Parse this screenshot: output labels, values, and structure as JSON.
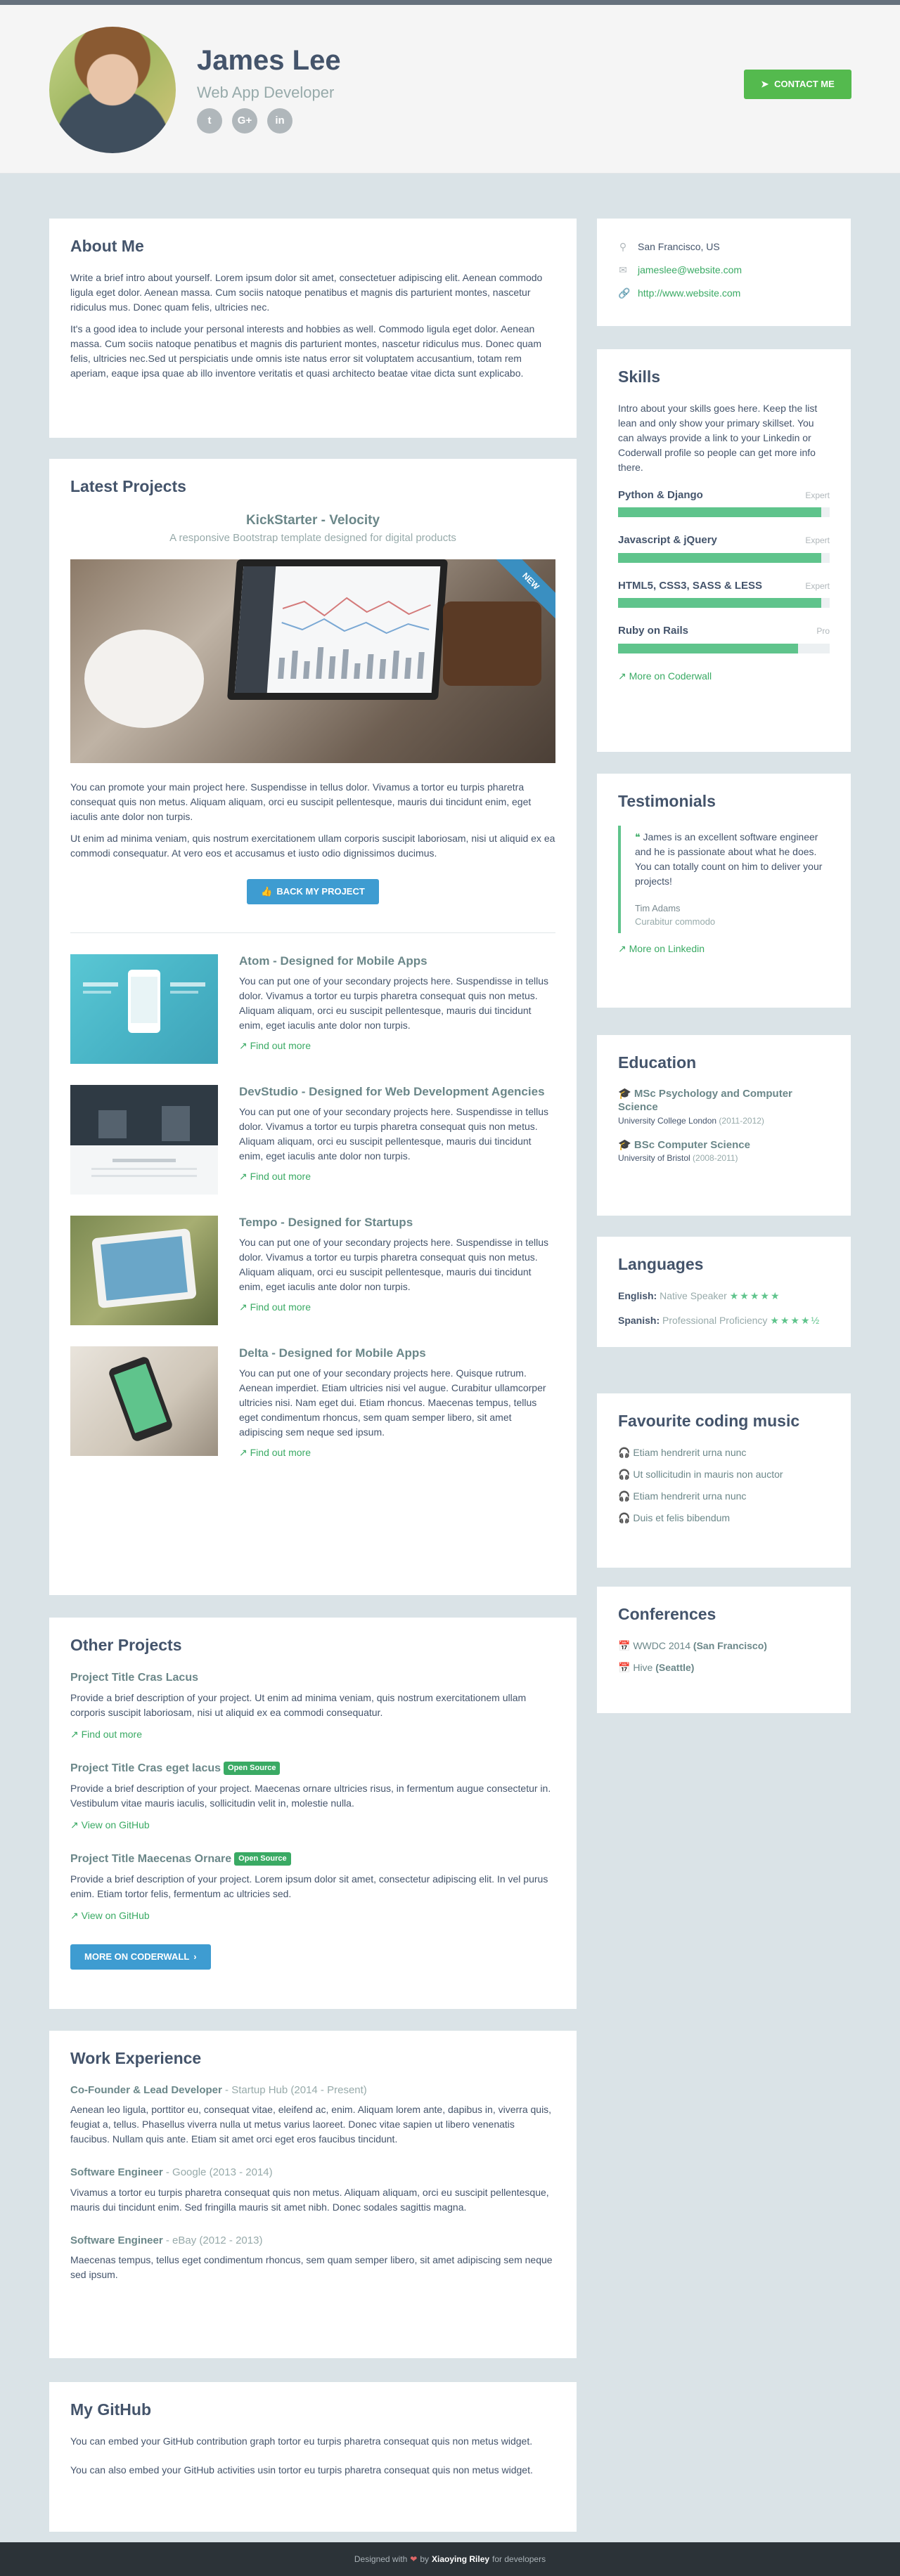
{
  "header": {
    "name": "James Lee",
    "title": "Web App Developer",
    "contact_label": "CONTACT ME",
    "social": [
      {
        "icon": "twitter-icon",
        "glyph": "t"
      },
      {
        "icon": "google-plus-icon",
        "glyph": "G+"
      },
      {
        "icon": "linkedin-icon",
        "glyph": "in"
      }
    ]
  },
  "about": {
    "heading": "About Me",
    "p1": "Write a brief intro about yourself. Lorem ipsum dolor sit amet, consectetuer adipiscing elit. Aenean commodo ligula eget dolor. Aenean massa. Cum sociis natoque penatibus et magnis dis parturient montes, nascetur ridiculus mus. Donec quam felis, ultricies nec.",
    "p2": "It's a good idea to include your personal interests and hobbies as well. Commodo ligula eget dolor. Aenean massa. Cum sociis natoque penatibus et magnis dis parturient montes, nascetur ridiculus mus. Donec quam felis, ultricies nec.Sed ut perspiciatis unde omnis iste natus error sit voluptatem accusantium, totam rem aperiam, eaque ipsa quae ab illo inventore veritatis et quasi architecto beatae vitae dicta sunt explicabo."
  },
  "latest": {
    "heading": "Latest Projects",
    "featured": {
      "title": "KickStarter - Velocity",
      "subtitle": "A responsive Bootstrap template designed for digital products",
      "ribbon": "NEW",
      "p1": "You can promote your main project here. Suspendisse in tellus dolor. Vivamus a tortor eu turpis pharetra consequat quis non metus. Aliquam aliquam, orci eu suscipit pellentesque, mauris dui tincidunt enim, eget iaculis ante dolor non turpis.",
      "p2": "Ut enim ad minima veniam, quis nostrum exercitationem ullam corporis suscipit laboriosam, nisi ut aliquid ex ea commodi consequatur. At vero eos et accusamus et iusto odio dignissimos ducimus.",
      "button": "BACK MY PROJECT"
    },
    "projects": [
      {
        "title": "Atom - Designed for Mobile Apps",
        "desc": "You can put one of your secondary projects here. Suspendisse in tellus dolor. Vivamus a tortor eu turpis pharetra consequat quis non metus. Aliquam aliquam, orci eu suscipit pellentesque, mauris dui tincidunt enim, eget iaculis ante dolor non turpis.",
        "link": "Find out more"
      },
      {
        "title": "DevStudio - Designed for Web Development Agencies",
        "desc": "You can put one of your secondary projects here. Suspendisse in tellus dolor. Vivamus a tortor eu turpis pharetra consequat quis non metus. Aliquam aliquam, orci eu suscipit pellentesque, mauris dui tincidunt enim, eget iaculis ante dolor non turpis.",
        "link": "Find out more"
      },
      {
        "title": "Tempo - Designed for Startups",
        "desc": "You can put one of your secondary projects here. Suspendisse in tellus dolor. Vivamus a tortor eu turpis pharetra consequat quis non metus. Aliquam aliquam, orci eu suscipit pellentesque, mauris dui tincidunt enim, eget iaculis ante dolor non turpis.",
        "link": "Find out more"
      },
      {
        "title": "Delta - Designed for Mobile Apps",
        "desc": "You can put one of your secondary projects here. Quisque rutrum. Aenean imperdiet. Etiam ultricies nisi vel augue. Curabitur ullamcorper ultricies nisi. Nam eget dui. Etiam rhoncus. Maecenas tempus, tellus eget condimentum rhoncus, sem quam semper libero, sit amet adipiscing sem neque sed ipsum.",
        "link": "Find out more"
      }
    ]
  },
  "other": {
    "heading": "Other Projects",
    "items": [
      {
        "title": "Project Title Cras Lacus",
        "badge": "",
        "desc": "Provide a brief description of your project. Ut enim ad minima veniam, quis nostrum exercitationem ullam corporis suscipit laboriosam, nisi ut aliquid ex ea commodi consequatur.",
        "link": "Find out more"
      },
      {
        "title": "Project Title Cras eget lacus",
        "badge": "Open Source",
        "desc": "Provide a brief description of your project. Maecenas ornare ultricies risus, in fermentum augue consectetur in. Vestibulum vitae mauris iaculis, sollicitudin velit in, molestie nulla.",
        "link": "View on GitHub"
      },
      {
        "title": "Project Title Maecenas Ornare",
        "badge": "Open Source",
        "desc": "Provide a brief description of your project. Lorem ipsum dolor sit amet, consectetur adipiscing elit. In vel purus enim. Etiam tortor felis, fermentum ac ultricies sed.",
        "link": "View on GitHub"
      }
    ],
    "button": "MORE ON CODERWALL"
  },
  "work": {
    "heading": "Work Experience",
    "items": [
      {
        "role": "Co-Founder & Lead Developer",
        "company": " - Startup Hub (2014 - Present)",
        "desc": "Aenean leo ligula, porttitor eu, consequat vitae, eleifend ac, enim. Aliquam lorem ante, dapibus in, viverra quis, feugiat a, tellus. Phasellus viverra nulla ut metus varius laoreet. Donec vitae sapien ut libero venenatis faucibus. Nullam quis ante. Etiam sit amet orci eget eros faucibus tincidunt."
      },
      {
        "role": "Software Engineer",
        "company": " - Google (2013 - 2014)",
        "desc": "Vivamus a tortor eu turpis pharetra consequat quis non metus. Aliquam aliquam, orci eu suscipit pellentesque, mauris dui tincidunt enim. Sed fringilla mauris sit amet nibh. Donec sodales sagittis magna."
      },
      {
        "role": "Software Engineer",
        "company": " - eBay (2012 - 2013)",
        "desc": "Maecenas tempus, tellus eget condimentum rhoncus, sem quam semper libero, sit amet adipiscing sem neque sed ipsum."
      }
    ]
  },
  "github": {
    "heading": "My GitHub",
    "p1": "You can embed your GitHub contribution graph tortor eu turpis pharetra consequat quis non metus widget.",
    "p2": "You can also embed your GitHub activities usin tortor eu turpis pharetra consequat quis non metus widget."
  },
  "info": {
    "location": "San Francisco, US",
    "email": "jameslee@website.com",
    "website": "http://www.website.com"
  },
  "skills": {
    "heading": "Skills",
    "intro": "Intro about your skills goes here. Keep the list lean and only show your primary skillset. You can always provide a link to your Linkedin or Coderwall profile so people can get more info there.",
    "items": [
      {
        "name": "Python & Django",
        "level": "Expert",
        "pct": 96
      },
      {
        "name": "Javascript & jQuery",
        "level": "Expert",
        "pct": 96
      },
      {
        "name": "HTML5, CSS3, SASS & LESS",
        "level": "Expert",
        "pct": 96
      },
      {
        "name": "Ruby on Rails",
        "level": "Pro",
        "pct": 85
      }
    ],
    "link": "More on Coderwall"
  },
  "testimonials": {
    "heading": "Testimonials",
    "quote": "James is an excellent software engineer and he is passionate about what he does. You can totally count on him to deliver your projects!",
    "name": "Tim Adams",
    "role": "Curabitur commodo",
    "link": "More on Linkedin"
  },
  "education": {
    "heading": "Education",
    "items": [
      {
        "degree": "MSc Psychology and Computer Science",
        "school": "University College London",
        "years": " (2011-2012)"
      },
      {
        "degree": "BSc Computer Science",
        "school": "University of Bristol",
        "years": " (2008-2011)"
      }
    ]
  },
  "languages": {
    "heading": "Languages",
    "items": [
      {
        "name": "English:",
        "level": " Native Speaker",
        "stars": "★★★★★"
      },
      {
        "name": "Spanish:",
        "level": " Professional Proficiency",
        "stars": "★★★★½"
      }
    ]
  },
  "music": {
    "heading": "Favourite coding music",
    "items": [
      "Etiam hendrerit urna nunc",
      "Ut sollicitudin in mauris non auctor",
      "Etiam hendrerit urna nunc",
      "Duis et felis bibendum"
    ]
  },
  "conferences": {
    "heading": "Conferences",
    "items": [
      {
        "name": "WWDC 2014",
        "place": "(San Francisco)"
      },
      {
        "name": "Hive",
        "place": "(Seattle)"
      }
    ]
  },
  "footer": {
    "prefix": "Designed with",
    "by": "by",
    "author": "Xiaoying Riley",
    "suffix": "for developers"
  }
}
